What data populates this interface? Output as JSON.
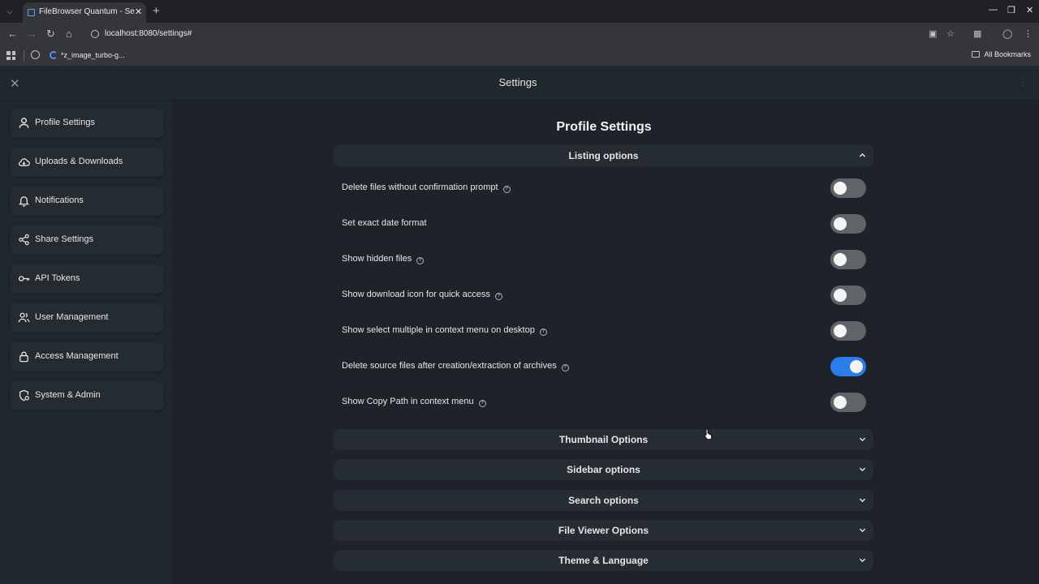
{
  "browser": {
    "tab_title": "FileBrowser Quantum - Settings",
    "url": "localhost:8080/settings#",
    "bookmark_label": "*z_image_turbo-g...",
    "all_bookmarks": "All Bookmarks",
    "accent": "#4ba3ff"
  },
  "app": {
    "title": "Settings",
    "close_icon": "close-icon",
    "more_icon": "more-vert-icon"
  },
  "sidebar": {
    "items": [
      {
        "label": "Profile Settings",
        "icon": "person-icon"
      },
      {
        "label": "Uploads & Downloads",
        "icon": "cloud-icon"
      },
      {
        "label": "Notifications",
        "icon": "bell-icon"
      },
      {
        "label": "Share Settings",
        "icon": "share-icon"
      },
      {
        "label": "API Tokens",
        "icon": "key-icon"
      },
      {
        "label": "User Management",
        "icon": "users-icon"
      },
      {
        "label": "Access Management",
        "icon": "lock-icon"
      },
      {
        "label": "System & Admin",
        "icon": "shield-gear-icon"
      }
    ]
  },
  "main": {
    "page_title": "Profile Settings",
    "listing": {
      "title": "Listing options",
      "expanded": true,
      "options": [
        {
          "label": "Delete files without confirmation prompt",
          "help": true,
          "enabled": false
        },
        {
          "label": "Set exact date format",
          "help": false,
          "enabled": false
        },
        {
          "label": "Show hidden files",
          "help": true,
          "enabled": false
        },
        {
          "label": "Show download icon for quick access",
          "help": true,
          "enabled": false
        },
        {
          "label": "Show select multiple in context menu on desktop",
          "help": true,
          "enabled": false
        },
        {
          "label": "Delete source files after creation/extraction of archives",
          "help": true,
          "enabled": true
        },
        {
          "label": "Show Copy Path in context menu",
          "help": true,
          "enabled": false
        }
      ]
    },
    "sections": [
      {
        "title": "Thumbnail Options",
        "expanded": false
      },
      {
        "title": "Sidebar options",
        "expanded": false
      },
      {
        "title": "Search options",
        "expanded": false
      },
      {
        "title": "File Viewer Options",
        "expanded": false
      },
      {
        "title": "Theme & Language",
        "expanded": false
      }
    ],
    "toggle_on_color": "#2b7de9",
    "toggle_off_color": "#5f6468"
  }
}
